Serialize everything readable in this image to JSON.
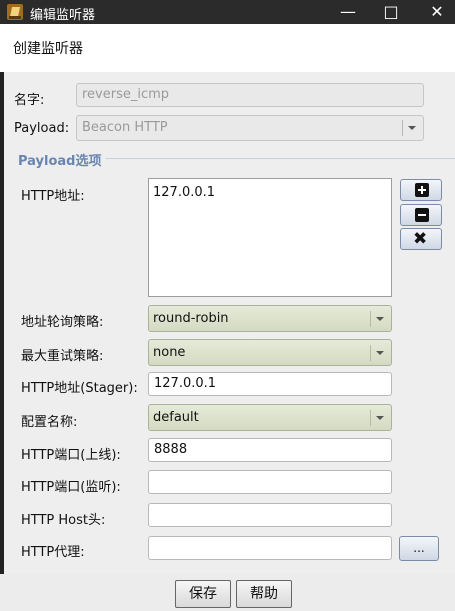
{
  "window": {
    "title": "编辑监听器"
  },
  "header": {
    "title": "创建监听器"
  },
  "form": {
    "name_label": "名字:",
    "name_value": "reverse_icmp",
    "payload_label": "Payload:",
    "payload_value": "Beacon HTTP",
    "group_title": "Payload选项",
    "http_address_label": "HTTP地址:",
    "http_address_value": "127.0.0.1",
    "rotation_label": "地址轮询策略:",
    "rotation_value": "round-robin",
    "retry_label": "最大重试策略:",
    "retry_value": "none",
    "stager_label": "HTTP地址(Stager):",
    "stager_value": "127.0.0.1",
    "profile_label": "配置名称:",
    "profile_value": "default",
    "port_label": "HTTP端口(上线):",
    "port_value": "8888",
    "bind_port_label": "HTTP端口(监听):",
    "bind_port_value": "",
    "host_header_label": "HTTP Host头:",
    "host_header_value": "",
    "proxy_label": "HTTP代理:",
    "proxy_value": "",
    "proxy_button": "..."
  },
  "footer": {
    "save": "保存",
    "help": "帮助"
  },
  "icons": [
    "app-icon",
    "minimize-icon",
    "maximize-icon",
    "close-icon",
    "add-icon",
    "remove-icon",
    "clear-icon",
    "dropdown-arrow-icon"
  ]
}
